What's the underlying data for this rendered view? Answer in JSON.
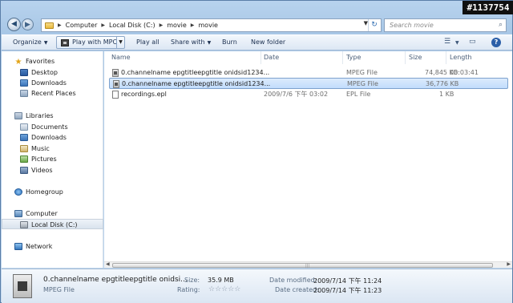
{
  "watermark": "#1137754",
  "address": {
    "crumbs": [
      "Computer",
      "Local Disk (C:)",
      "movie",
      "movie"
    ]
  },
  "search": {
    "placeholder": "Search movie"
  },
  "toolbar": {
    "organize": "Organize",
    "play_with": "Play with MPC",
    "play_all": "Play all",
    "share_with": "Share with",
    "burn": "Burn",
    "new_folder": "New folder"
  },
  "nav": {
    "favorites": "Favorites",
    "desktop": "Desktop",
    "downloads": "Downloads",
    "recent": "Recent Places",
    "libraries": "Libraries",
    "documents": "Documents",
    "lib_downloads": "Downloads",
    "music": "Music",
    "pictures": "Pictures",
    "videos": "Videos",
    "homegroup": "Homegroup",
    "computer": "Computer",
    "local_disk": "Local Disk (C:)",
    "network": "Network"
  },
  "columns": {
    "name": "Name",
    "date": "Date",
    "type": "Type",
    "size": "Size",
    "length": "Length"
  },
  "files": [
    {
      "name": "0.channelname    epgtitleepgtitle    onidsid1234...",
      "date": "",
      "type": "MPEG File",
      "size": "74,845 KB",
      "length": "00:03:41"
    },
    {
      "name": "0.channelname    epgtitleepgtitle    onidsid1234...",
      "date": "",
      "type": "MPEG File",
      "size": "36,776 KB",
      "length": ""
    },
    {
      "name": "recordings.epl",
      "date": "2009/7/6 下午 03:02",
      "type": "EPL File",
      "size": "1 KB",
      "length": ""
    }
  ],
  "details": {
    "name": "0.channelname    epgtitleepgtitle    onidsi...",
    "type": "MPEG File",
    "size_label": "Size:",
    "size_value": "35.9 MB",
    "rating_label": "Rating:",
    "rating": 0,
    "modified_label": "Date modified:",
    "modified_value": "2009/7/14 下午 11:24",
    "created_label": "Date created:",
    "created_value": "2009/7/14 下午 11:23"
  }
}
